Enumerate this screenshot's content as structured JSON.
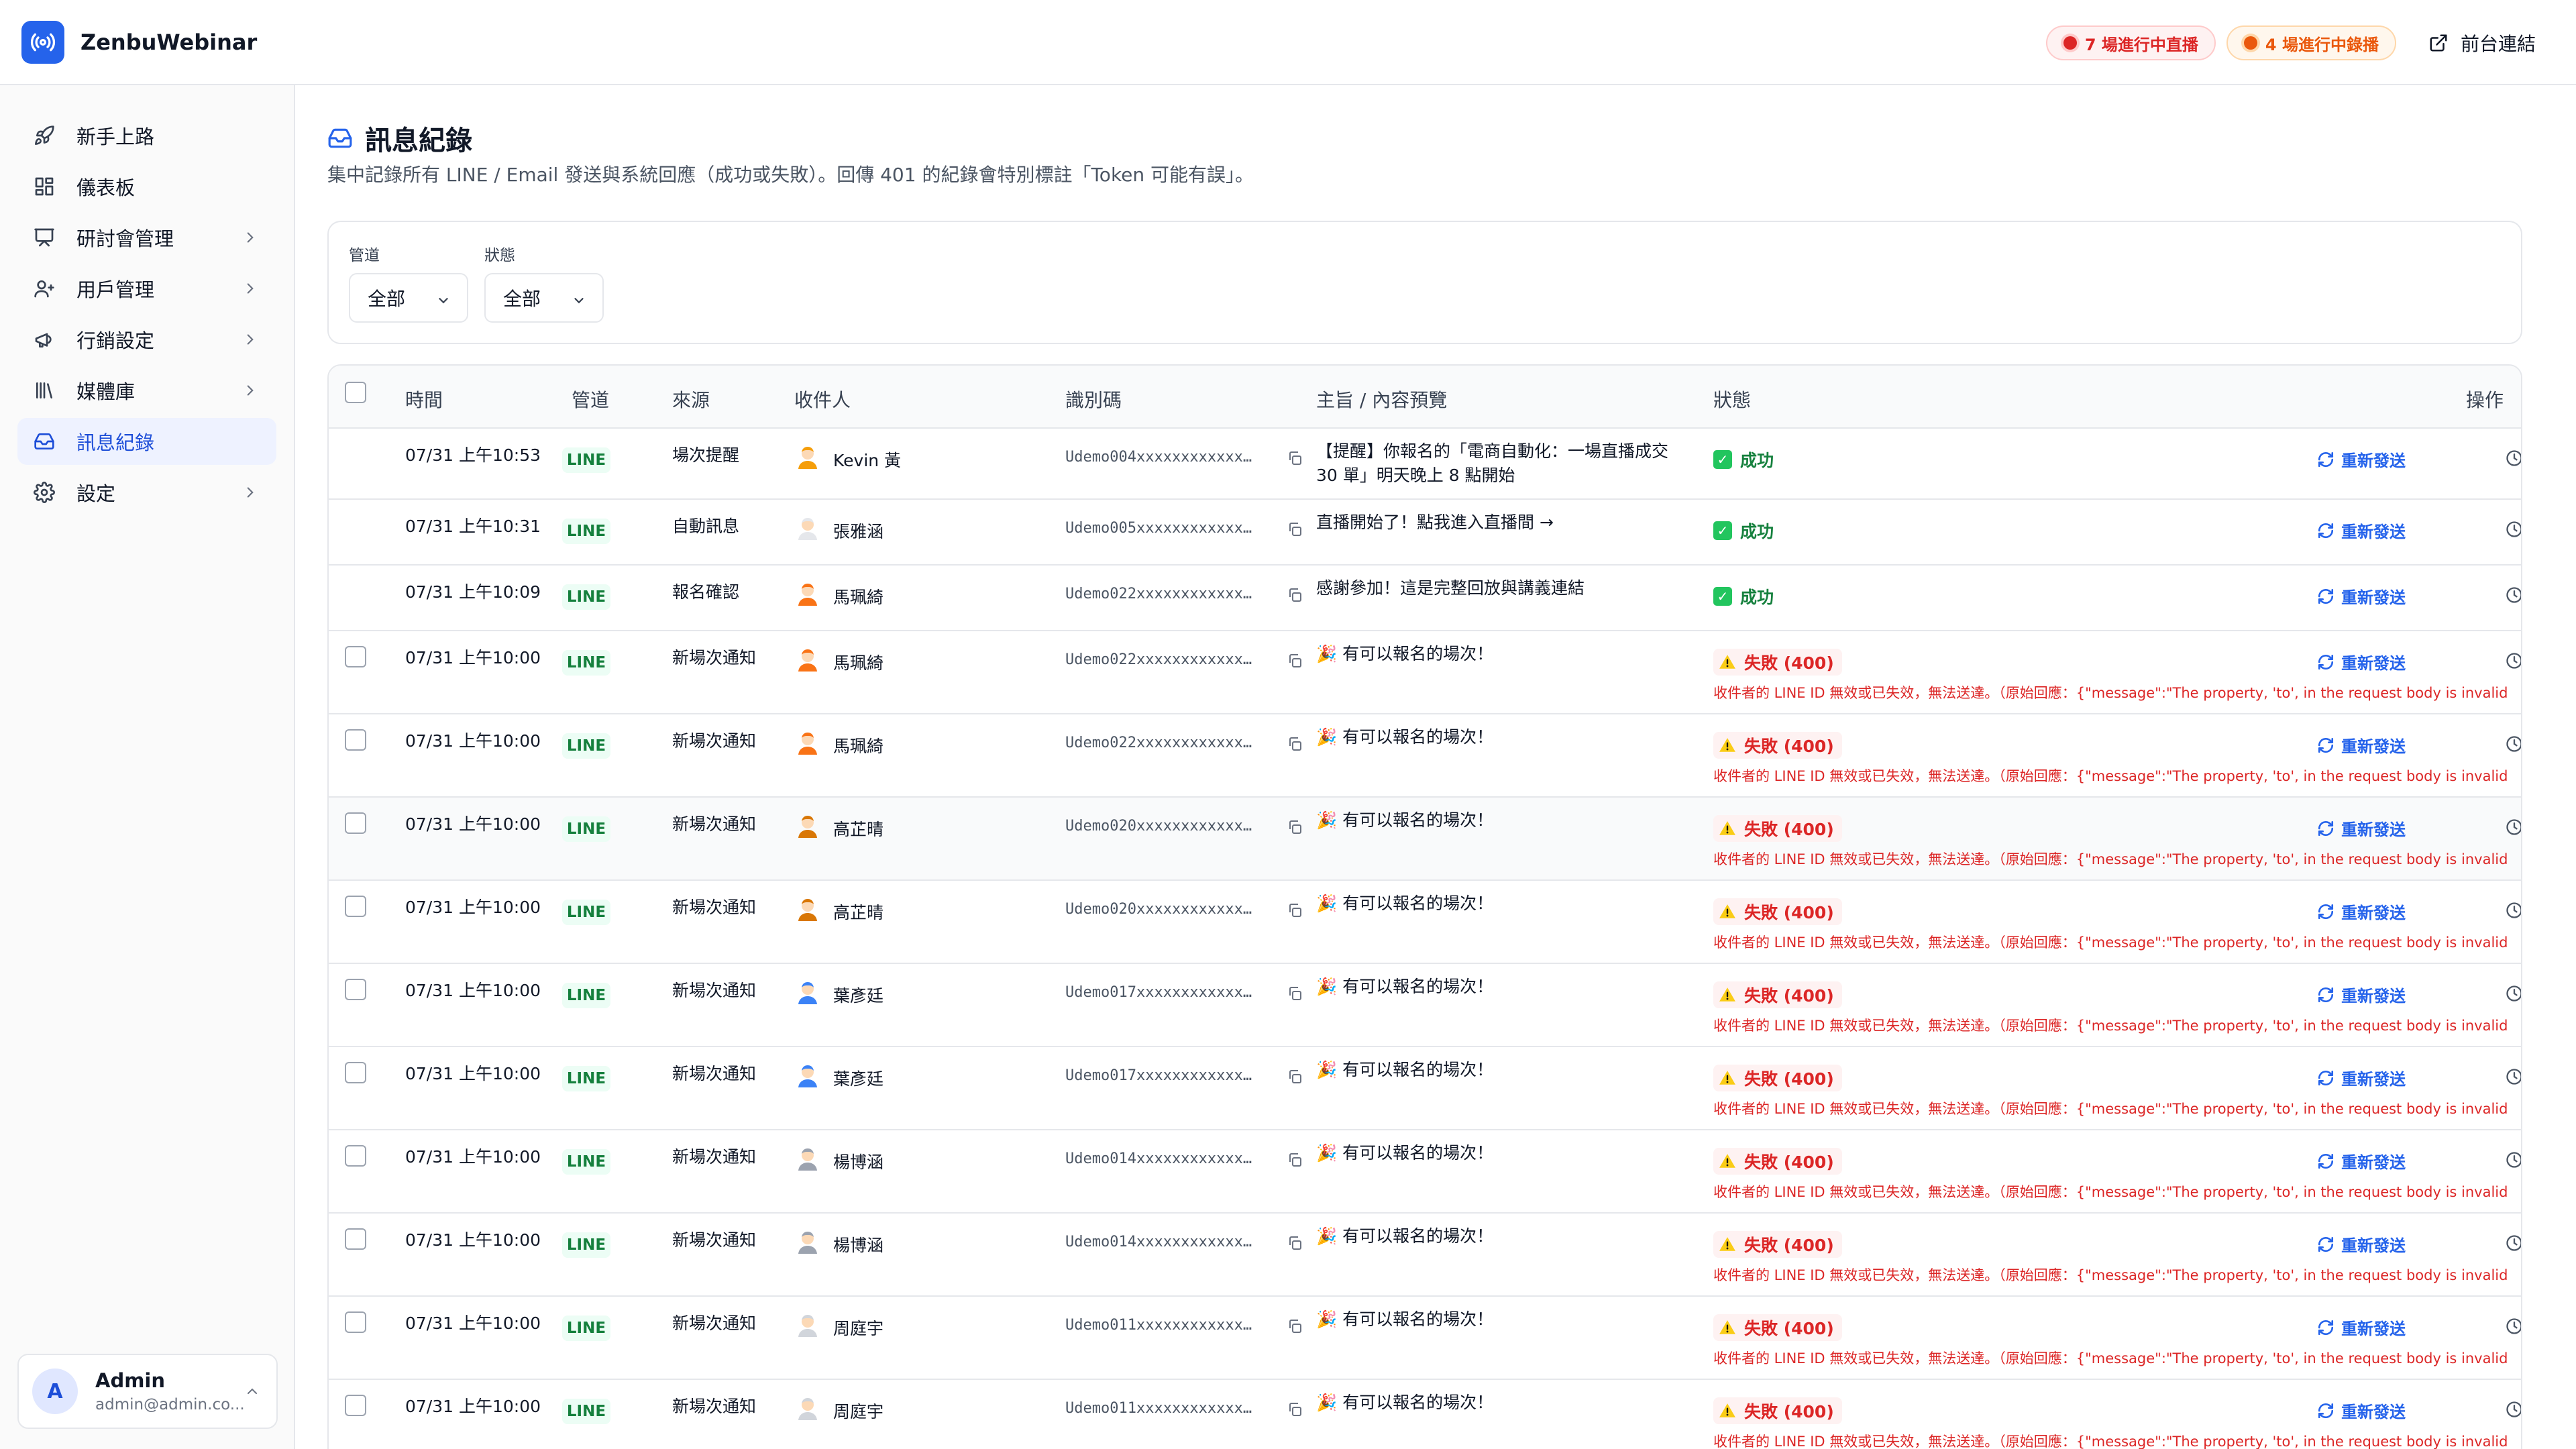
{
  "brand": {
    "name": "ZenbuWebinar"
  },
  "header": {
    "live_pill": "7 場進行中直播",
    "replay_pill": "4 場進行中錄播",
    "front_link": "前台連結"
  },
  "sidebar": {
    "items": [
      {
        "label": "新手上路",
        "icon": "rocket-icon"
      },
      {
        "label": "儀表板",
        "icon": "dashboard-icon"
      },
      {
        "label": "研討會管理",
        "icon": "presentation-icon"
      },
      {
        "label": "用戶管理",
        "icon": "users-icon"
      },
      {
        "label": "行銷設定",
        "icon": "megaphone-icon"
      },
      {
        "label": "媒體庫",
        "icon": "library-icon"
      },
      {
        "label": "訊息紀錄",
        "icon": "inbox-icon"
      },
      {
        "label": "設定",
        "icon": "gear-icon"
      }
    ],
    "user": {
      "initial": "A",
      "name": "Admin",
      "email": "admin@admin.co..."
    }
  },
  "page": {
    "title": "訊息紀錄",
    "description": "集中記錄所有 LINE / Email 發送與系統回應（成功或失敗）。回傳 401 的紀錄會特別標註「Token 可能有誤」。"
  },
  "filters": {
    "channel_label": "管道",
    "channel_value": "全部",
    "status_label": "狀態",
    "status_value": "全部"
  },
  "table": {
    "headers": {
      "time": "時間",
      "channel": "管道",
      "source": "來源",
      "recipient": "收件人",
      "identifier": "識別碼",
      "subject": "主旨 / 內容預覽",
      "status": "狀態",
      "actions": "操作"
    },
    "resend_label": "重新發送",
    "error_message": "收件者的 LINE ID 無效或已失效，無法送達。（原始回應：{\"message\":\"The property, 'to', in the request body is invalid",
    "rows": [
      {
        "time": "07/31 上午10:53",
        "channel": "LINE",
        "source": "場次提醒",
        "recipient": "Kevin 黃",
        "identifier": "Udemo004xxxxxxxxxxxx…",
        "subject_1": "【提醒】你報名的「電商自動化：一場直播成交",
        "subject_2": "30 單」明天晚上 8 點開始",
        "status": "成功"
      },
      {
        "time": "07/31 上午10:31",
        "channel": "LINE",
        "source": "自動訊息",
        "recipient": "張雅涵",
        "identifier": "Udemo005xxxxxxxxxxxx…",
        "subject_1": "直播開始了！點我進入直播間 →",
        "status": "成功"
      },
      {
        "time": "07/31 上午10:09",
        "channel": "LINE",
        "source": "報名確認",
        "recipient": "馬珮綺",
        "identifier": "Udemo022xxxxxxxxxxxx…",
        "subject_1": "感謝參加！這是完整回放與講義連結",
        "status": "成功"
      },
      {
        "time": "07/31 上午10:00",
        "channel": "LINE",
        "source": "新場次通知",
        "recipient": "馬珮綺",
        "identifier": "Udemo022xxxxxxxxxxxx…",
        "subject_1": "🎉 有可以報名的場次！",
        "status": "失敗 (400)"
      },
      {
        "time": "07/31 上午10:00",
        "channel": "LINE",
        "source": "新場次通知",
        "recipient": "馬珮綺",
        "identifier": "Udemo022xxxxxxxxxxxx…",
        "subject_1": "🎉 有可以報名的場次！",
        "status": "失敗 (400)"
      },
      {
        "time": "07/31 上午10:00",
        "channel": "LINE",
        "source": "新場次通知",
        "recipient": "高芷晴",
        "identifier": "Udemo020xxxxxxxxxxxx…",
        "subject_1": "🎉 有可以報名的場次！",
        "status": "失敗 (400)"
      },
      {
        "time": "07/31 上午10:00",
        "channel": "LINE",
        "source": "新場次通知",
        "recipient": "高芷晴",
        "identifier": "Udemo020xxxxxxxxxxxx…",
        "subject_1": "🎉 有可以報名的場次！",
        "status": "失敗 (400)"
      },
      {
        "time": "07/31 上午10:00",
        "channel": "LINE",
        "source": "新場次通知",
        "recipient": "葉彥廷",
        "identifier": "Udemo017xxxxxxxxxxxx…",
        "subject_1": "🎉 有可以報名的場次！",
        "status": "失敗 (400)"
      },
      {
        "time": "07/31 上午10:00",
        "channel": "LINE",
        "source": "新場次通知",
        "recipient": "葉彥廷",
        "identifier": "Udemo017xxxxxxxxxxxx…",
        "subject_1": "🎉 有可以報名的場次！",
        "status": "失敗 (400)"
      },
      {
        "time": "07/31 上午10:00",
        "channel": "LINE",
        "source": "新場次通知",
        "recipient": "楊博涵",
        "identifier": "Udemo014xxxxxxxxxxxx…",
        "subject_1": "🎉 有可以報名的場次！",
        "status": "失敗 (400)"
      },
      {
        "time": "07/31 上午10:00",
        "channel": "LINE",
        "source": "新場次通知",
        "recipient": "楊博涵",
        "identifier": "Udemo014xxxxxxxxxxxx…",
        "subject_1": "🎉 有可以報名的場次！",
        "status": "失敗 (400)"
      },
      {
        "time": "07/31 上午10:00",
        "channel": "LINE",
        "source": "新場次通知",
        "recipient": "周庭宇",
        "identifier": "Udemo011xxxxxxxxxxxx…",
        "subject_1": "🎉 有可以報名的場次！",
        "status": "失敗 (400)"
      },
      {
        "time": "07/31 上午10:00",
        "channel": "LINE",
        "source": "新場次通知",
        "recipient": "周庭宇",
        "identifier": "Udemo011xxxxxxxxxxxx…",
        "subject_1": "🎉 有可以報名的場次！",
        "status": "失敗 (400)"
      }
    ]
  },
  "colors": {
    "accent": "#2563eb",
    "success": "#15803d",
    "error": "#dc2626",
    "warning": "#ea580c"
  }
}
